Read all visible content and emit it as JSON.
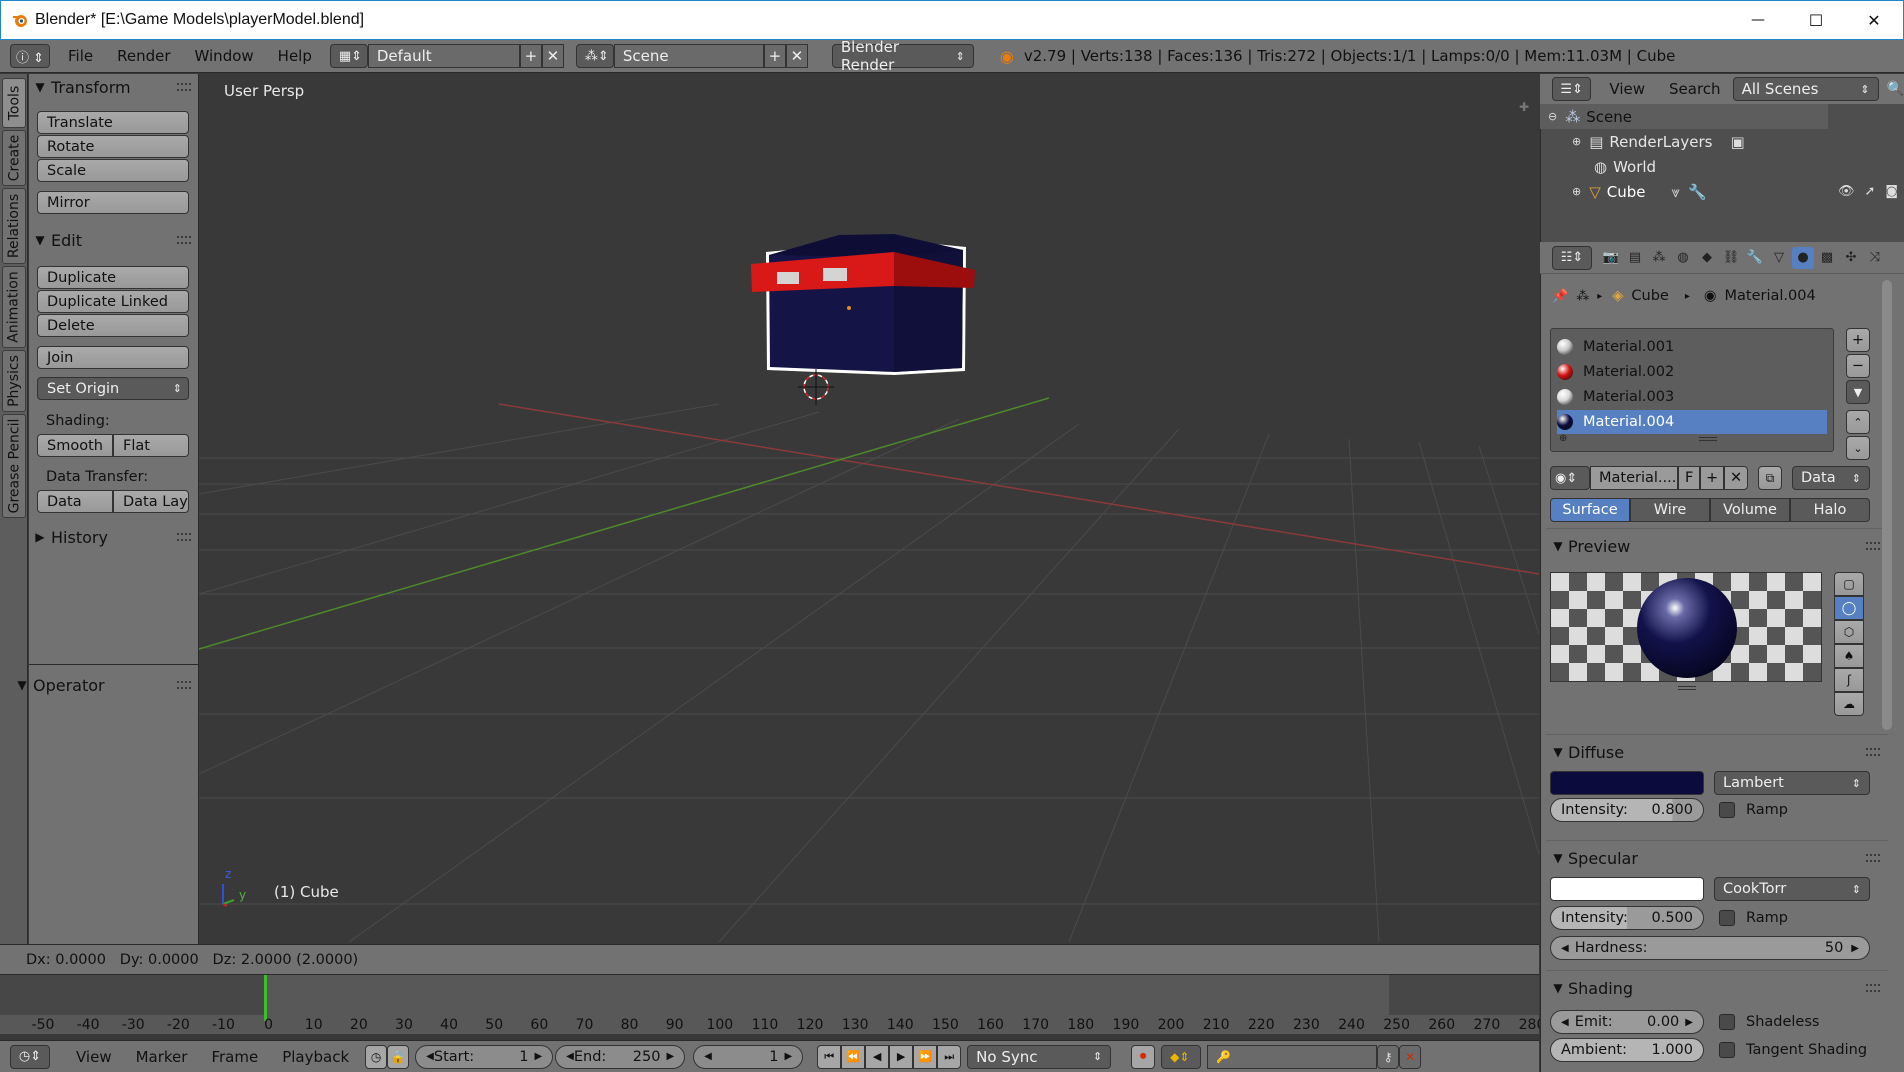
{
  "window": {
    "title": "Blender* [E:\\Game Models\\playerModel.blend]",
    "minimize_glyph": "—",
    "maximize_glyph": "☐",
    "close_glyph": "✕"
  },
  "info_header": {
    "menus": [
      "File",
      "Render",
      "Window",
      "Help"
    ],
    "screen_layout": "Default",
    "scene": "Scene",
    "render_engine": "Blender Render",
    "stats": "v2.79 | Verts:138 | Faces:136 | Tris:272 | Objects:1/1 | Lamps:0/0 | Mem:11.03M | Cube"
  },
  "left_tabs": [
    "Tools",
    "Create",
    "Relations",
    "Animation",
    "Physics",
    "Grease Pencil"
  ],
  "tool_shelf": {
    "transform_header": "Transform",
    "translate": "Translate",
    "rotate": "Rotate",
    "scale": "Scale",
    "mirror": "Mirror",
    "edit_header": "Edit",
    "duplicate": "Duplicate",
    "duplicate_linked": "Duplicate Linked",
    "delete": "Delete",
    "join": "Join",
    "set_origin": "Set Origin",
    "shading_label": "Shading:",
    "smooth": "Smooth",
    "flat": "Flat",
    "data_transfer_label": "Data Transfer:",
    "data": "Data",
    "data_lay": "Data Lay",
    "history_header": "History",
    "operator_header": "Operator"
  },
  "viewport": {
    "view_name": "User Persp",
    "object_label": "(1) Cube",
    "axis_z": "z",
    "axis_y": "y"
  },
  "status": {
    "text": "Dx: 0.0000   Dy: 0.0000   Dz: 2.0000 (2.0000)"
  },
  "timeline": {
    "ticks": [
      "-50",
      "-40",
      "-30",
      "-20",
      "-10",
      "0",
      "10",
      "20",
      "30",
      "40",
      "50",
      "60",
      "70",
      "80",
      "90",
      "100",
      "110",
      "120",
      "130",
      "140",
      "150",
      "160",
      "170",
      "180",
      "190",
      "200",
      "210",
      "220",
      "230",
      "240",
      "250",
      "260",
      "270",
      "280"
    ],
    "current_frame_marker": 0,
    "menus": [
      "View",
      "Marker",
      "Frame",
      "Playback"
    ],
    "start_label": "Start:",
    "start_value": "1",
    "end_label": "End:",
    "end_value": "250",
    "current_frame": "1",
    "sync": "No Sync"
  },
  "outliner": {
    "menus": [
      "View",
      "Search"
    ],
    "scope": "All Scenes",
    "rows": [
      "Scene",
      "RenderLayers",
      "World",
      "Cube"
    ]
  },
  "properties": {
    "breadcrumb_object": "Cube",
    "breadcrumb_material": "Material.004",
    "materials": [
      "Material.001",
      "Material.002",
      "Material.003",
      "Material.004"
    ],
    "material_colors": [
      "#c8c8c8",
      "#d21010",
      "#d8d8d8",
      "#0a0a3c"
    ],
    "selected_index": 3,
    "material_field": "Material....",
    "fake_user": "F",
    "link_mode": "Data",
    "tabs": [
      "Surface",
      "Wire",
      "Volume",
      "Halo"
    ],
    "preview_header": "Preview",
    "diffuse_header": "Diffuse",
    "diffuse_color": "#0b0b3e",
    "diffuse_shader": "Lambert",
    "diffuse_intensity_label": "Intensity:",
    "diffuse_intensity": "0.800",
    "ramp": "Ramp",
    "specular_header": "Specular",
    "specular_color": "#ffffff",
    "specular_shader": "CookTorr",
    "specular_intensity_label": "Intensity:",
    "specular_intensity": "0.500",
    "hardness_label": "Hardness:",
    "hardness": "50",
    "shading_header": "Shading",
    "emit_label": "Emit:",
    "emit": "0.00",
    "shadeless": "Shadeless",
    "ambient_label": "Ambient:",
    "ambient": "1.000",
    "tangent_shading": "Tangent Shading"
  }
}
